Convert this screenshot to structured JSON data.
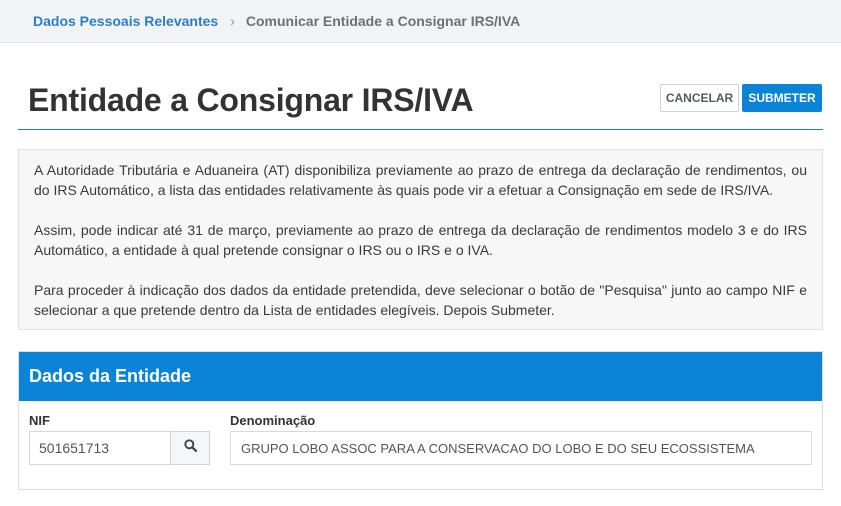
{
  "breadcrumb": {
    "items": [
      "Dados Pessoais Relevantes",
      "Comunicar Entidade a Consignar IRS/IVA"
    ],
    "separator": "›"
  },
  "page": {
    "title": "Entidade a Consignar IRS/IVA"
  },
  "actions": {
    "cancel_label": "CANCELAR",
    "submit_label": "SUBMETER"
  },
  "info": {
    "paragraphs": [
      "A Autoridade Tributária e Aduaneira (AT) disponibiliza previamente ao prazo de entrega da declaração de rendimentos, ou do IRS Automático, a lista das entidades relativamente às quais pode vir a efetuar a Consignação em sede de IRS/IVA.",
      "Assim, pode indicar até 31 de março, previamente ao prazo de entrega da declaração de rendimentos modelo 3 e do IRS Automático, a entidade à qual pretende consignar o IRS ou o IRS e o IVA.",
      "Para proceder à indicação dos dados da entidade pretendida, deve selecionar o botão de \"Pesquisa\" junto ao campo NIF e selecionar a que pretende dentro da Lista de entidades elegíveis. Depois Submeter."
    ]
  },
  "entity_panel": {
    "title": "Dados da Entidade",
    "nif_label": "NIF",
    "nif_value": "501651713",
    "denominacao_label": "Denominação",
    "denominacao_value": "GRUPO LOBO ASSOC PARA A CONSERVACAO DO LOBO E DO SEU ECOSSISTEMA",
    "search_icon": "search-icon"
  },
  "colors": {
    "accent": "#0b84d8",
    "link": "#2a7fc4",
    "breadcrumb_bg": "#f2f3f5",
    "info_bg": "#f7f7f7"
  }
}
